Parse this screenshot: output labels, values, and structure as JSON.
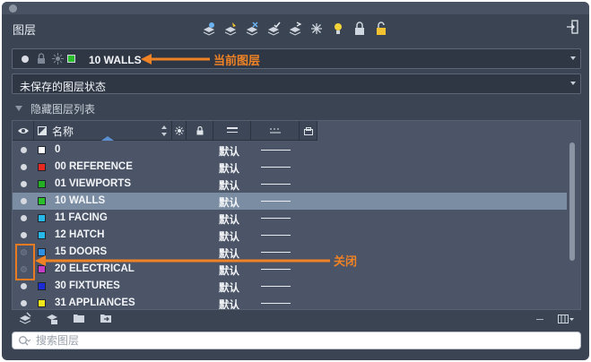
{
  "palette": {
    "title": "图层",
    "toolbar_icons": [
      "new-layer-icon",
      "new-layer-frozen-icon",
      "delete-layer-icon",
      "set-current-icon",
      "layer-match-icon",
      "freeze-icon",
      "isolate-icon",
      "lock-icon",
      "unlock-icon"
    ]
  },
  "current_layer": {
    "name": "10 WALLS"
  },
  "layer_state": {
    "value": "未保存的图层状态"
  },
  "hidden_list_toggle": {
    "label": "隐藏图层列表"
  },
  "table": {
    "columns": {
      "name": "名称"
    },
    "rows": [
      {
        "name": "0",
        "color": "#ffffff",
        "linetype": "默认",
        "on": true,
        "selected": false
      },
      {
        "name": "00 REFERENCE",
        "color": "#e8291f",
        "linetype": "默认",
        "on": true,
        "selected": false
      },
      {
        "name": "01 VIEWPORTS",
        "color": "#23b023",
        "linetype": "默认",
        "on": true,
        "selected": false
      },
      {
        "name": "10 WALLS",
        "color": "#2bbf2b",
        "linetype": "默认",
        "on": true,
        "selected": true
      },
      {
        "name": "11 FACING",
        "color": "#27b7e8",
        "linetype": "默认",
        "on": true,
        "selected": false
      },
      {
        "name": "12 HATCH",
        "color": "#27b7e8",
        "linetype": "默认",
        "on": true,
        "selected": false
      },
      {
        "name": "15 DOORS",
        "color": "#2f8fe3",
        "linetype": "默认",
        "on": false,
        "selected": false
      },
      {
        "name": "20 ELECTRICAL",
        "color": "#c43cc4",
        "linetype": "默认",
        "on": false,
        "selected": false
      },
      {
        "name": "30 FIXTURES",
        "color": "#1b2bd6",
        "linetype": "默认",
        "on": true,
        "selected": false
      },
      {
        "name": "31 APPLIANCES",
        "color": "#f0e81a",
        "linetype": "默认",
        "on": true,
        "selected": false
      }
    ]
  },
  "annotations": {
    "current": "当前图层",
    "off": "关闭",
    "color": "#e97b23"
  },
  "search": {
    "placeholder": "搜索图层"
  }
}
